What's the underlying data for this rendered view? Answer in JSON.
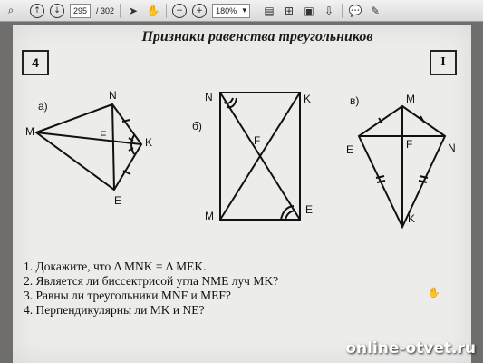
{
  "toolbar": {
    "page_current": "295",
    "page_total": "/ 302",
    "zoom": "180%"
  },
  "page": {
    "title": "Признаки равенства треугольников",
    "badge_left": "4",
    "badge_right": "I",
    "parts": {
      "a": "а)",
      "b": "б)",
      "v": "в)"
    },
    "fig_a": {
      "N": "N",
      "M": "M",
      "F": "F",
      "K": "K",
      "E": "E"
    },
    "fig_b": {
      "N": "N",
      "K": "K",
      "F": "F",
      "M": "M",
      "E": "E"
    },
    "fig_v": {
      "M": "M",
      "E": "E",
      "F": "F",
      "N": "N",
      "K": "K"
    },
    "questions": [
      "1. Докажите, что Δ MNK = Δ MEK.",
      "2. Является ли биссектрисой угла NME луч MK?",
      "3. Равны ли треугольники MNF и MEF?",
      "4. Перпендикулярны ли MK и NE?"
    ]
  },
  "watermark": "online-otvet.ru",
  "icons": [
    "search-icon",
    "arrow-up-icon",
    "arrow-down-icon",
    "pointer-icon",
    "hand-icon",
    "zoom-out-icon",
    "zoom-in-icon",
    "dropdown-icon",
    "page-icon",
    "fit-icon",
    "doc-icon",
    "comment-icon",
    "pen-icon"
  ]
}
